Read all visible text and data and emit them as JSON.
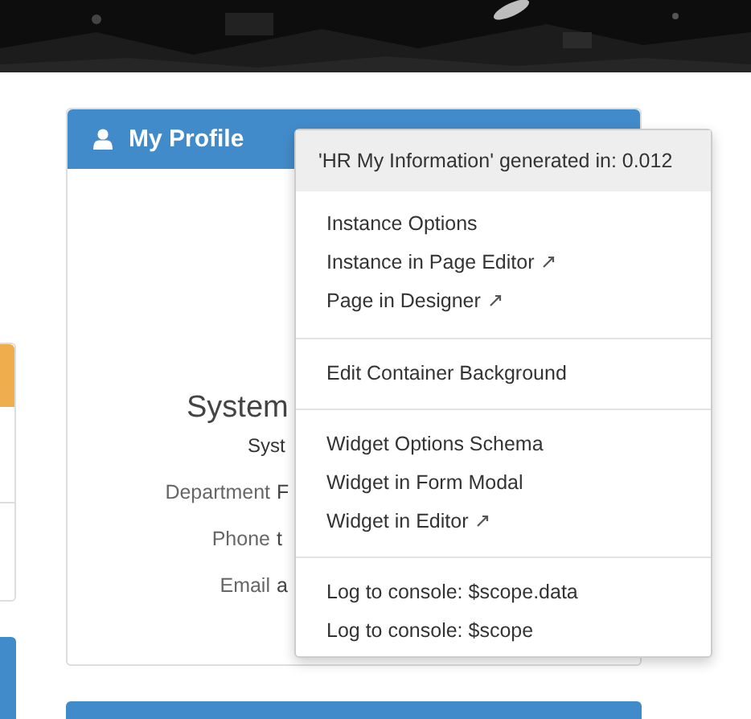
{
  "profile_card": {
    "title": "My Profile",
    "name": "System",
    "subtitle": "Syst",
    "fields": [
      {
        "label": "Department",
        "value": "F"
      },
      {
        "label": "Phone",
        "value": "t"
      },
      {
        "label": "Email",
        "value": "a"
      }
    ]
  },
  "context_menu": {
    "header": "'HR My Information' generated in: 0.012",
    "groups": [
      [
        {
          "label": "Instance Options",
          "external": false
        },
        {
          "label": "Instance in Page Editor",
          "external": true
        },
        {
          "label": "Page in Designer",
          "external": true
        }
      ],
      [
        {
          "label": "Edit Container Background",
          "external": false
        }
      ],
      [
        {
          "label": "Widget Options Schema",
          "external": false
        },
        {
          "label": "Widget in Form Modal",
          "external": false
        },
        {
          "label": "Widget in Editor",
          "external": true
        }
      ],
      [
        {
          "label": "Log to console: $scope.data",
          "external": false
        },
        {
          "label": "Log to console: $scope",
          "external": false
        }
      ]
    ]
  }
}
